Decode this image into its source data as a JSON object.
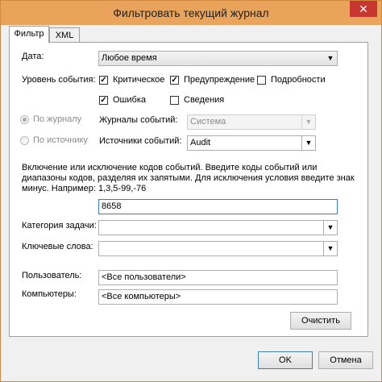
{
  "window": {
    "title": "Фильтровать текущий журнал",
    "close_glyph": "✕"
  },
  "tabs": [
    {
      "label": "Фильтр"
    },
    {
      "label": "XML"
    }
  ],
  "filter": {
    "date_label": "Дата:",
    "date_value": "Любое время",
    "level_label": "Уровень события:",
    "levels": [
      {
        "label": "Критическое",
        "checked": true
      },
      {
        "label": "Предупреждение",
        "checked": true
      },
      {
        "label": "Подробности",
        "checked": false
      },
      {
        "label": "Ошибка",
        "checked": true
      },
      {
        "label": "Сведения",
        "checked": false
      }
    ],
    "by_log_label": "По журналу",
    "by_source_label": "По источнику",
    "event_logs_label": "Журналы событий:",
    "event_logs_value": "Система",
    "event_sources_label": "Источники событий:",
    "event_sources_value": "Audit",
    "ids_help": "Включение или исключение кодов событий. Введите коды событий или диапазоны кодов, разделяя их запятыми. Для исключения условия введите знак минус. Например: 1,3,5-99,-76",
    "ids_value": "8658",
    "task_category_label": "Категория задачи:",
    "task_category_value": "",
    "keywords_label": "Ключевые слова:",
    "keywords_value": "",
    "user_label": "Пользователь:",
    "user_value": "<Все пользователи>",
    "computers_label": "Компьютеры:",
    "computers_value": "<Все компьютеры>",
    "clear_label": "Очистить"
  },
  "ok_label": "OK",
  "cancel_label": "Отмена"
}
